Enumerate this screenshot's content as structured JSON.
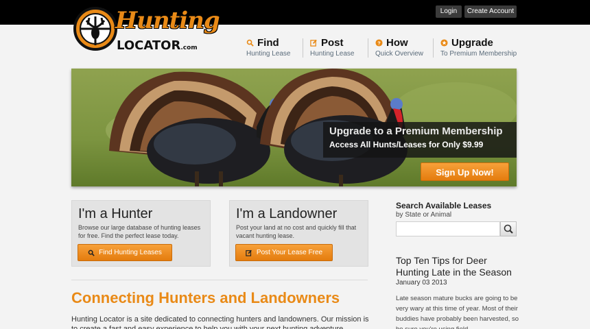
{
  "topbar": {
    "login": "Login",
    "create_account": "Create Account"
  },
  "logo": {
    "word1": "Hunting",
    "word2": "LOCATOR",
    "suffix": ".com"
  },
  "nav": [
    {
      "title": "Find",
      "subtitle": "Hunting Lease",
      "icon": "search-icon"
    },
    {
      "title": "Post",
      "subtitle": "Hunting Lease",
      "icon": "edit-icon"
    },
    {
      "title": "How",
      "subtitle": "Quick Overview",
      "icon": "question-icon"
    },
    {
      "title": "Upgrade",
      "subtitle": "To Premium Membership",
      "icon": "star-icon"
    }
  ],
  "hero": {
    "headline": "Upgrade to a Premium Membership",
    "subline": "Access All Hunts/Leases for Only $9.99",
    "button": "Sign Up Now!"
  },
  "cards": {
    "hunter": {
      "title": "I'm a Hunter",
      "text": "Browse our large database of hunting leases for free. Find the perfect lease today.",
      "button": "Find Hunting Leases"
    },
    "landowner": {
      "title": "I'm a Landowner",
      "text": "Post your land at no cost and quickly fill that vacant hunting lease.",
      "button": "Post Your Lease Free"
    }
  },
  "main": {
    "tagline": "Connecting Hunters and Landowners",
    "intro": "Hunting Locator is a site dedicated to connecting hunters and landowners. Our mission is to create a fast and easy experience to help you with your next hunting adventure."
  },
  "search": {
    "title": "Search Available Leases",
    "subtitle": "by State or Animal",
    "placeholder": ""
  },
  "post": {
    "title": "Top Ten Tips for Deer Hunting Late in the Season",
    "date": "January 03 2013",
    "text": "Late season mature bucks are going to be very wary at this time of year. Most of their buddies have probably been harvested, so be sure you're using field"
  },
  "colors": {
    "accent": "#e98a17",
    "dark": "#000000"
  }
}
